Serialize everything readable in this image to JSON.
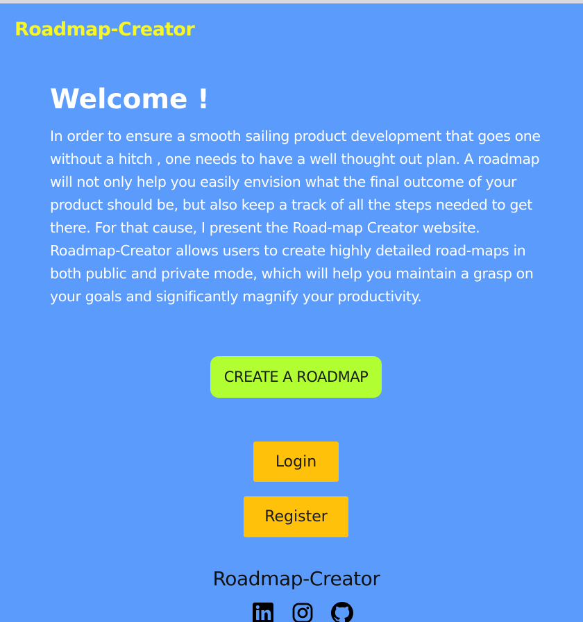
{
  "header": {
    "brand": "Roadmap-Creator"
  },
  "main": {
    "heading": "Welcome !",
    "intro": "In order to ensure a smooth sailing product development that goes one without a hitch , one needs to have a well thought out plan. A roadmap will not only help you easily envision what the final outcome of your product should be, but also keep a track of all the steps needed to get there. For that cause, I present the Road-map Creator website. Roadmap-Creator allows users to create highly detailed road-maps in both public and private mode, which will help you maintain a grasp on your goals and significantly magnify your productivity.",
    "create_label": "CREATE A ROADMAP",
    "login_label": "Login",
    "register_label": "Register"
  },
  "footer": {
    "brand": "Roadmap-Creator",
    "icons": [
      "linkedin-icon",
      "instagram-icon",
      "github-icon"
    ]
  },
  "colors": {
    "background": "#5b9bfb",
    "brand": "#f6f629",
    "create_button": "#b1ff32",
    "auth_buttons": "#ffc10a"
  }
}
